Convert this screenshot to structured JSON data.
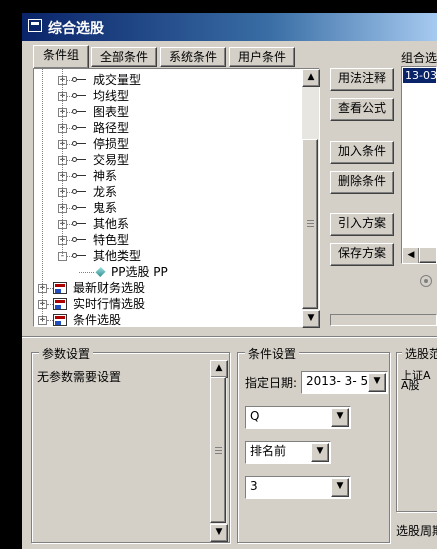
{
  "window": {
    "title": "综合选股"
  },
  "tabs": [
    "条件组",
    "全部条件",
    "系统条件",
    "用户条件"
  ],
  "tree": {
    "items": [
      {
        "label": "成交量型",
        "level": 1,
        "expand": "+"
      },
      {
        "label": "均线型",
        "level": 1,
        "expand": "+"
      },
      {
        "label": "图表型",
        "level": 1,
        "expand": "+"
      },
      {
        "label": "路径型",
        "level": 1,
        "expand": "+"
      },
      {
        "label": "停损型",
        "level": 1,
        "expand": "+"
      },
      {
        "label": "交易型",
        "level": 1,
        "expand": "+"
      },
      {
        "label": "神系",
        "level": 1,
        "expand": "+"
      },
      {
        "label": "龙系",
        "level": 1,
        "expand": "+"
      },
      {
        "label": "鬼系",
        "level": 1,
        "expand": "+"
      },
      {
        "label": "其他系",
        "level": 1,
        "expand": "+"
      },
      {
        "label": "特色型",
        "level": 1,
        "expand": "+"
      },
      {
        "label": "其他类型",
        "level": 1,
        "expand": "-"
      },
      {
        "label": "PP选股 PP",
        "level": 2,
        "expand": ""
      },
      {
        "label": "最新财务选股",
        "level": 0,
        "expand": "+"
      },
      {
        "label": "实时行情选股",
        "level": 0,
        "expand": "+"
      },
      {
        "label": "条件选股",
        "level": 0,
        "expand": "+"
      }
    ]
  },
  "buttons": {
    "usage": "用法注释",
    "view_formula": "查看公式",
    "add_condition": "加入条件",
    "delete_condition": "删除条件",
    "import_plan": "引入方案",
    "save_plan": "保存方案"
  },
  "combo_panel": {
    "label": "组合选",
    "item": "13-03"
  },
  "param_panel": {
    "title": "参数设置",
    "text": "无参数需要设置"
  },
  "condition_panel": {
    "title": "条件设置",
    "date_label": "指定日期:",
    "date_value": "2013- 3- 5",
    "field1": "Q",
    "field2": "排名前",
    "field3": "3"
  },
  "range_panel": {
    "title": "选股范",
    "line1": "上证A",
    "line2": "A股"
  },
  "cycle_label": "选股周期"
}
